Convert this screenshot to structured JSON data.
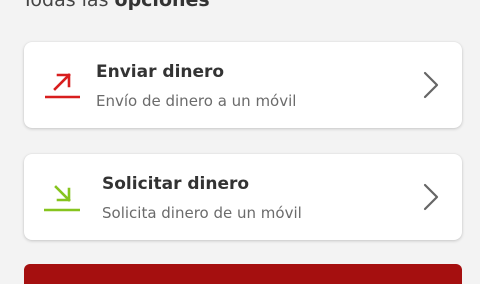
{
  "section": {
    "title_prefix": "Todas las ",
    "title_bold": "opciones"
  },
  "options": [
    {
      "title": "Enviar dinero",
      "subtitle": "Envío de dinero a un móvil",
      "icon": "arrow-up-right-icon",
      "icon_color": "#d81e1e"
    },
    {
      "title": "Solicitar dinero",
      "subtitle": "Solicita dinero de un móvil",
      "icon": "arrow-down-right-icon",
      "icon_color": "#86c41e"
    }
  ],
  "colors": {
    "background": "#f3f3f3",
    "card": "#ffffff",
    "accent": "#a50f0f",
    "chevron": "#666666"
  }
}
